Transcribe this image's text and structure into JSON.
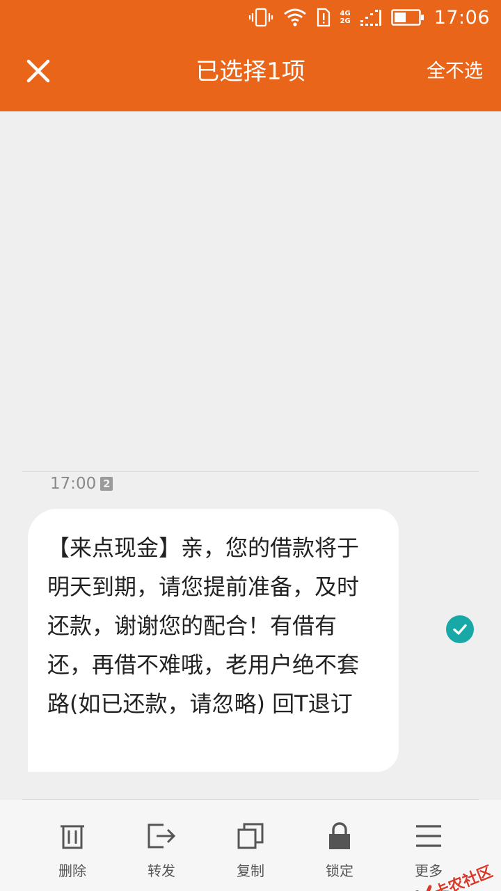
{
  "status_bar": {
    "time": "17:06",
    "network_top": "4G",
    "network_bottom": "2G",
    "icons": [
      "vibrate-icon",
      "wifi-icon",
      "sim-alert-icon",
      "signal-icon",
      "battery-icon"
    ]
  },
  "header": {
    "title": "已选择1项",
    "deselect_all": "全不选",
    "close_icon": "close-icon"
  },
  "message": {
    "time": "17:00",
    "sim_slot": "2",
    "text": "【来点现金】亲，您的借款将于明天到期，请您提前准备，及时还款，谢谢您的配合！有借有还，再借不难哦，老用户绝不套路(如已还款，请忽略) 回T退订",
    "selected": true
  },
  "toolbar": {
    "items": [
      {
        "label": "删除",
        "icon": "trash-icon"
      },
      {
        "label": "转发",
        "icon": "forward-icon"
      },
      {
        "label": "复制",
        "icon": "copy-icon"
      },
      {
        "label": "锁定",
        "icon": "lock-icon"
      },
      {
        "label": "更多",
        "icon": "menu-icon"
      }
    ]
  },
  "watermark": {
    "text": "卡农社区"
  },
  "colors": {
    "accent": "#e8651a",
    "check": "#18a9a6",
    "background": "#efefef",
    "bubble": "#ffffff"
  }
}
